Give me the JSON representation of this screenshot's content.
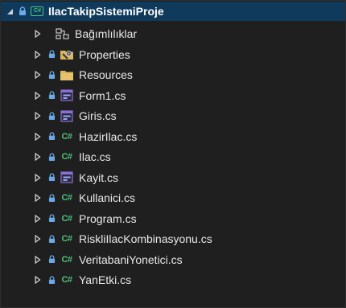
{
  "project": {
    "name": "IlacTakipSistemiProje",
    "badge": "C#"
  },
  "items": [
    {
      "label": "Bağımlılıklar",
      "icon": "dependencies-icon",
      "locked": false
    },
    {
      "label": "Properties",
      "icon": "properties-folder-icon",
      "locked": true
    },
    {
      "label": "Resources",
      "icon": "folder-icon",
      "locked": true
    },
    {
      "label": "Form1.cs",
      "icon": "winform-icon",
      "locked": true
    },
    {
      "label": "Giris.cs",
      "icon": "winform-icon",
      "locked": true
    },
    {
      "label": "HazirIlac.cs",
      "icon": "csharp-file-icon",
      "locked": true
    },
    {
      "label": "Ilac.cs",
      "icon": "csharp-file-icon",
      "locked": true
    },
    {
      "label": "Kayit.cs",
      "icon": "winform-icon",
      "locked": true
    },
    {
      "label": "Kullanici.cs",
      "icon": "csharp-file-icon",
      "locked": true
    },
    {
      "label": "Program.cs",
      "icon": "csharp-file-icon",
      "locked": true
    },
    {
      "label": "RiskliIlacKombinasyonu.cs",
      "icon": "csharp-file-icon",
      "locked": true
    },
    {
      "label": "VeritabaniYonetici.cs",
      "icon": "csharp-file-icon",
      "locked": true
    },
    {
      "label": "YanEtki.cs",
      "icon": "csharp-file-icon",
      "locked": true
    }
  ],
  "cs_glyph": "C#",
  "colors": {
    "background": "#1f1f1f",
    "selected": "#0f3a5c",
    "csharp_green": "#4fc07a",
    "lock_blue": "#6aa9e6",
    "folder_yellow": "#d9b65a",
    "form_purple": "#8b6fd6"
  }
}
